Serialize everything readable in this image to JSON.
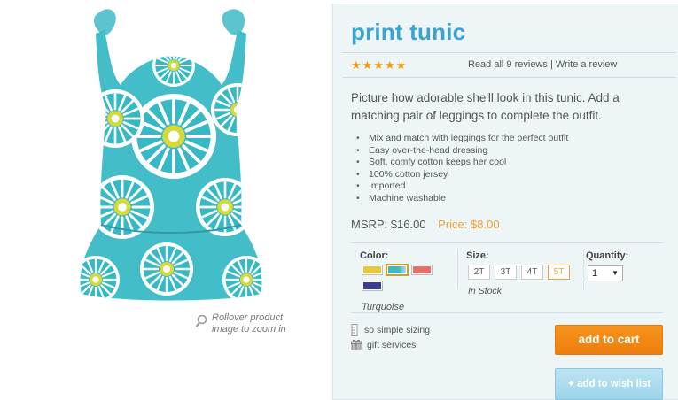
{
  "product": {
    "title": "print tunic",
    "rating_stars": 5,
    "reviews": {
      "read_all": "Read all 9 reviews",
      "separator": "|",
      "write": "Write a review"
    },
    "description": "Picture how adorable she'll look in this tunic. Add a matching pair of leggings to complete the outfit.",
    "features": [
      "Mix and match with leggings for the perfect outfit",
      "Easy over-the-head dressing",
      "Soft, comfy cotton keeps her cool",
      "100% cotton jersey",
      "Imported",
      "Machine washable"
    ],
    "msrp": "MSRP: $16.00",
    "price": "Price: $8.00"
  },
  "image": {
    "zoom_hint_line1": "Rollover product",
    "zoom_hint_line2": "image to zoom in"
  },
  "options": {
    "color_label": "Color:",
    "colors": [
      {
        "name": "yellow",
        "hex": "#e4c93b",
        "selected": false
      },
      {
        "name": "Turquoise",
        "hex": "#3fb8c6",
        "selected": true
      },
      {
        "name": "coral",
        "hex": "#ee6b6b",
        "selected": false
      },
      {
        "name": "navy",
        "hex": "#3a3d8c",
        "selected": false
      }
    ],
    "selected_color": "Turquoise",
    "size_label": "Size:",
    "sizes": [
      {
        "label": "2T",
        "selected": false
      },
      {
        "label": "3T",
        "selected": false
      },
      {
        "label": "4T",
        "selected": false
      },
      {
        "label": "5T",
        "selected": true
      }
    ],
    "stock_status": "In Stock",
    "quantity_label": "Quantity:",
    "quantity_value": "1"
  },
  "helpers": {
    "sizing": "so simple sizing",
    "gift": "gift services"
  },
  "buttons": {
    "add_to_cart": "add to cart",
    "wishlist": "add to wish list"
  },
  "colors": {
    "title": "#3aa3cf",
    "price": "#f0a030",
    "cart_button": "#f7941d",
    "wish_button": "#aedcee"
  }
}
